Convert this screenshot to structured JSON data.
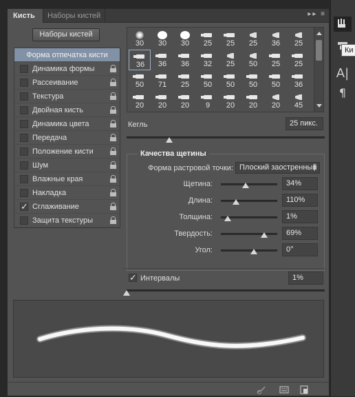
{
  "tabs": {
    "active": "Кисть",
    "inactive": "Наборы кистей",
    "menu": "▸▸ ≡"
  },
  "presets_button": "Наборы кистей",
  "options": [
    {
      "label": "Форма отпечатка кисти",
      "header": true
    },
    {
      "label": "Динамика формы",
      "checked": false
    },
    {
      "label": "Рассеивание",
      "checked": false
    },
    {
      "label": "Текстура",
      "checked": false
    },
    {
      "label": "Двойная кисть",
      "checked": false
    },
    {
      "label": "Динамика цвета",
      "checked": false
    },
    {
      "label": "Передача",
      "checked": false
    },
    {
      "label": "Положение кисти",
      "checked": false
    },
    {
      "label": "Шум",
      "checked": false
    },
    {
      "label": "Влажные края",
      "checked": false
    },
    {
      "label": "Накладка",
      "checked": false
    },
    {
      "label": "Сглаживание",
      "checked": true
    },
    {
      "label": "Защита текстуры",
      "checked": false
    }
  ],
  "tips": [
    {
      "n": "30",
      "s": "soft"
    },
    {
      "n": "30",
      "s": "round"
    },
    {
      "n": "30",
      "s": "round"
    },
    {
      "n": "25",
      "s": "brush"
    },
    {
      "n": "25",
      "s": "brush"
    },
    {
      "n": "25",
      "s": "brush2"
    },
    {
      "n": "36",
      "s": "brush2"
    },
    {
      "n": "25",
      "s": "brush2"
    },
    {
      "n": "36",
      "s": "brush",
      "selected": true
    },
    {
      "n": "36",
      "s": "brush"
    },
    {
      "n": "36",
      "s": "brush"
    },
    {
      "n": "32",
      "s": "brush"
    },
    {
      "n": "25",
      "s": "brush2"
    },
    {
      "n": "50",
      "s": "brush2"
    },
    {
      "n": "25",
      "s": "brush"
    },
    {
      "n": "25",
      "s": "brush"
    },
    {
      "n": "50",
      "s": "brush"
    },
    {
      "n": "71",
      "s": "brush"
    },
    {
      "n": "25",
      "s": "brush"
    },
    {
      "n": "50",
      "s": "brush"
    },
    {
      "n": "50",
      "s": "brush"
    },
    {
      "n": "50",
      "s": "brush"
    },
    {
      "n": "50",
      "s": "brush"
    },
    {
      "n": "36",
      "s": "brush"
    },
    {
      "n": "20",
      "s": "brush"
    },
    {
      "n": "20",
      "s": "brush"
    },
    {
      "n": "20",
      "s": "brush"
    },
    {
      "n": "9",
      "s": "brush"
    },
    {
      "n": "20",
      "s": "brush"
    },
    {
      "n": "20",
      "s": "brush"
    },
    {
      "n": "20",
      "s": "brush2"
    },
    {
      "n": "45",
      "s": "brush2"
    }
  ],
  "size": {
    "label": "Кегль",
    "value": "25 пикс."
  },
  "bristle": {
    "title": "Качества щетины",
    "raster_label": "Форма растровой точки:",
    "raster_value": "Плоский заостренный",
    "params": [
      {
        "label": "Щетина:",
        "value": "34%"
      },
      {
        "label": "Длина:",
        "value": "110%"
      },
      {
        "label": "Толщина:",
        "value": "1%"
      },
      {
        "label": "Твердость:",
        "value": "69%"
      },
      {
        "label": "Угол:",
        "value": "0°"
      }
    ]
  },
  "intervals": {
    "label": "Интервалы",
    "checked": true,
    "value": "1%"
  },
  "right_strip": {
    "tooltip": "Ки"
  },
  "colors": {
    "panel": "#535353",
    "selection": "#8292a6"
  }
}
